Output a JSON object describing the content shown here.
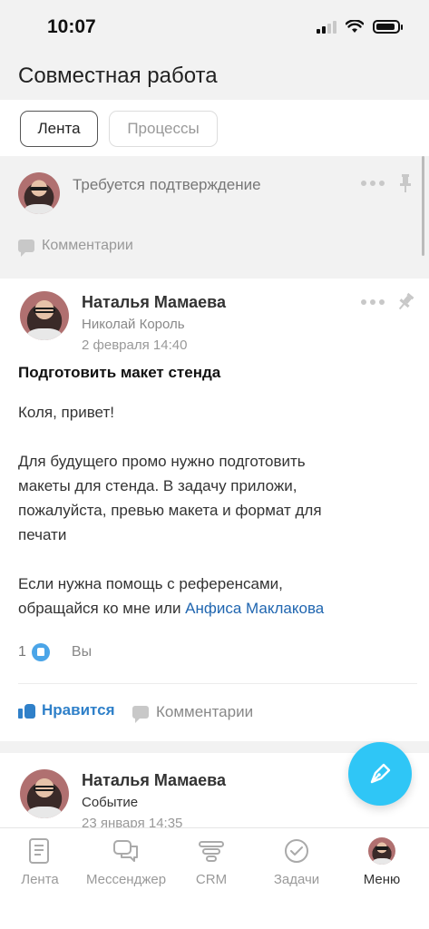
{
  "status_bar": {
    "time": "10:07"
  },
  "header": {
    "title": "Совместная работа"
  },
  "tabs": [
    {
      "label": "Лента",
      "active": true
    },
    {
      "label": "Процессы",
      "active": false
    }
  ],
  "feed": {
    "confirmation_post": {
      "title": "Требуется подтверждение",
      "comments_label": "Комментарии"
    },
    "task_post": {
      "author": "Наталья Мамаева",
      "recipient": "Николай Король",
      "date": "2 февраля 14:40",
      "task_title": "Подготовить макет стенда",
      "greeting": "Коля, привет!",
      "paragraph1_lines": [
        "Для будущего промо нужно подготовить",
        "макеты для стенда. В задачу приложи,",
        "пожалуйста, превью макета и формат для",
        "печати"
      ],
      "paragraph2_line1": "Если нужна помощь с референсами,",
      "paragraph2_line2_prefix": "обращайся ко мне или ",
      "mention": "Анфиса Маклакова",
      "likes_count": "1",
      "likes_you": "Вы",
      "like_button": "Нравится",
      "comments_button": "Комментарии"
    },
    "event_post": {
      "author": "Наталья Мамаева",
      "type": "Событие",
      "date": "23 января 14:35"
    }
  },
  "bottom_nav": [
    {
      "label": "Лента",
      "icon": "feed-icon",
      "active": false
    },
    {
      "label": "Мессенджер",
      "icon": "messenger-icon",
      "active": false
    },
    {
      "label": "CRM",
      "icon": "crm-icon",
      "active": false
    },
    {
      "label": "Задачи",
      "icon": "tasks-icon",
      "active": false
    },
    {
      "label": "Меню",
      "icon": "menu-avatar",
      "active": true
    }
  ],
  "colors": {
    "accent_blue": "#2f80c9",
    "fab": "#2fc6f6",
    "mention": "#2066b0"
  }
}
